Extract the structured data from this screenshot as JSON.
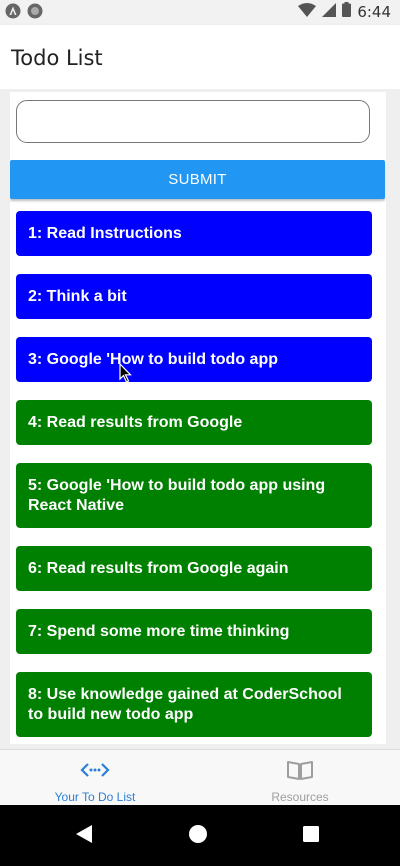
{
  "status_bar": {
    "time": "6:44"
  },
  "app_bar": {
    "title": "Todo List"
  },
  "form": {
    "input_value": "",
    "submit_label": "SUBMIT"
  },
  "todos": [
    {
      "text": "1: Read Instructions",
      "status": "blue"
    },
    {
      "text": "2: Think a bit",
      "status": "blue"
    },
    {
      "text": "3: Google 'How to build todo app",
      "status": "blue"
    },
    {
      "text": "4: Read results from Google",
      "status": "green"
    },
    {
      "text": "5: Google 'How to build todo app using React Native",
      "status": "green"
    },
    {
      "text": "6: Read results from Google again",
      "status": "green"
    },
    {
      "text": "7: Spend some more time thinking",
      "status": "green"
    },
    {
      "text": "8: Use knowledge gained at CoderSchool to build new todo app",
      "status": "green"
    }
  ],
  "tabs": [
    {
      "label": "Your To Do List",
      "icon": "code-icon",
      "active": true
    },
    {
      "label": "Resources",
      "icon": "book-icon",
      "active": false
    }
  ],
  "colors": {
    "accent": "#2196f3",
    "todo_blue": "#0000ff",
    "todo_green": "#008000",
    "tab_active": "#2b7fd6",
    "tab_inactive": "#9e9e9e"
  }
}
